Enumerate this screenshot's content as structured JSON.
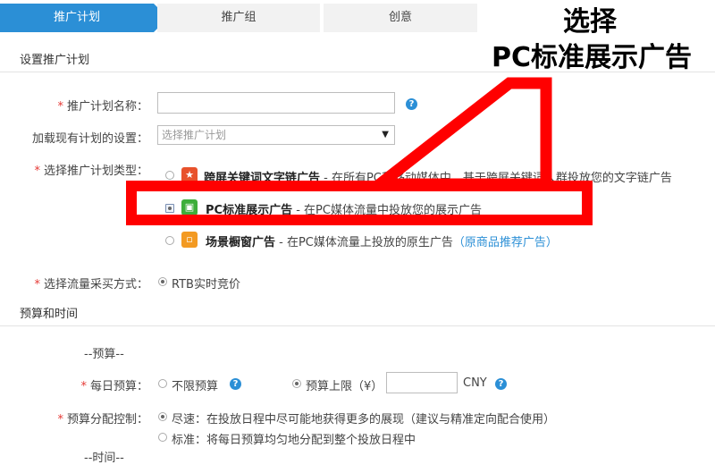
{
  "steps": [
    "推广计划",
    "推广组",
    "创意"
  ],
  "sections": {
    "plan": "设置推广计划",
    "budget": "预算和时间"
  },
  "fields": {
    "name_label": "推广计划名称：",
    "load_label": "加载现有计划的设置：",
    "load_placeholder": "选择推广计划",
    "type_label": "选择推广计划类型：",
    "flow_label": "选择流量采买方式：",
    "flow_value": "RTB实时竞价"
  },
  "plan_types": [
    {
      "title": "跨屏关键词文字链广告",
      "desc": " - 在所有PC和移动媒体中，基于跨屏关键词人群投放您的文字链广告"
    },
    {
      "title": "PC标准展示广告",
      "desc": " - 在PC媒体流量中投放您的展示广告"
    },
    {
      "title": "场景橱窗广告",
      "desc": " - 在PC媒体流量上投放的原生广告",
      "link": "（原商品推荐广告）"
    }
  ],
  "budget": {
    "budget_header": "--预算--",
    "daily_label": "每日预算：",
    "unlimited": "不限预算",
    "limit": "预算上限（¥）",
    "currency": "CNY",
    "alloc_label": "预算分配控制：",
    "fast": "尽速：在投放日程中尽可能地获得更多的展现（建议与精准定向配合使用）",
    "standard": "标准：将每日预算均匀地分配到整个投放日程中",
    "time_header": "--时间--"
  },
  "annotation": {
    "line1": "选择",
    "line2": "PC标准展示广告"
  },
  "colors": {
    "accent": "#2b8fd6",
    "annotation": "#ff0000"
  },
  "icons": [
    "keyword-icon",
    "monitor-icon",
    "window-icon",
    "help-icon"
  ]
}
